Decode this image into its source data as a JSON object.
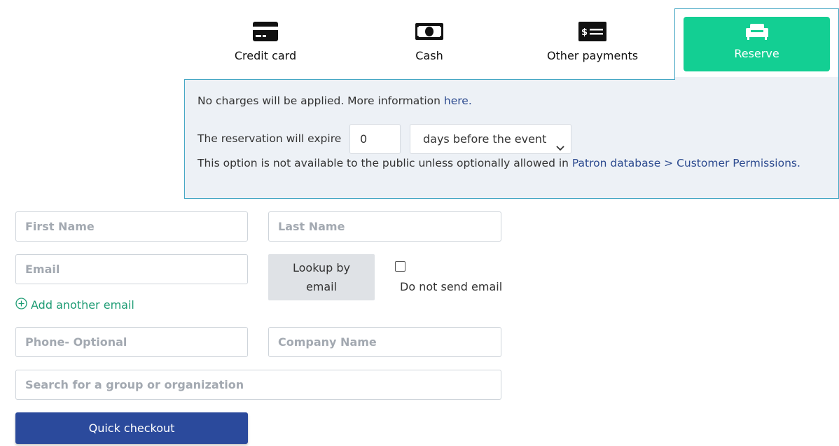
{
  "tabs": {
    "credit_card": "Credit card",
    "cash": "Cash",
    "other_payments": "Other payments",
    "reserve": "Reserve"
  },
  "reserve_panel": {
    "info_text": "No charges will be applied. More information ",
    "info_link": "here.",
    "expire_label": "The reservation will expire",
    "days_value": "0",
    "days_option": "days before the event",
    "availability_text": "This option is not available to the public unless optionally allowed in ",
    "availability_link": "Patron database > Customer Permissions."
  },
  "form": {
    "first_name_placeholder": "First Name",
    "last_name_placeholder": "Last Name",
    "email_placeholder": "Email",
    "lookup_button": "Lookup by email",
    "do_not_send_email": "Do not send email",
    "add_another_email": "Add another email",
    "phone_placeholder": "Phone- Optional",
    "company_placeholder": "Company Name",
    "group_search_placeholder": "Search for a group or organization",
    "quick_checkout": "Quick checkout"
  },
  "colors": {
    "reserve_green": "#13cf93",
    "checkout_blue": "#2b4a9c",
    "link_blue": "#2c4a8f",
    "add_email_green": "#1e9c74",
    "panel_border": "#45a7c4",
    "panel_bg": "#edf1f6"
  },
  "icons": {
    "credit_card": "credit-card-icon",
    "cash": "cash-icon",
    "other_payments": "money-check-icon",
    "reserve": "armchair-icon",
    "add_email": "plus-circle-icon",
    "select": "chevron-down-icon"
  }
}
